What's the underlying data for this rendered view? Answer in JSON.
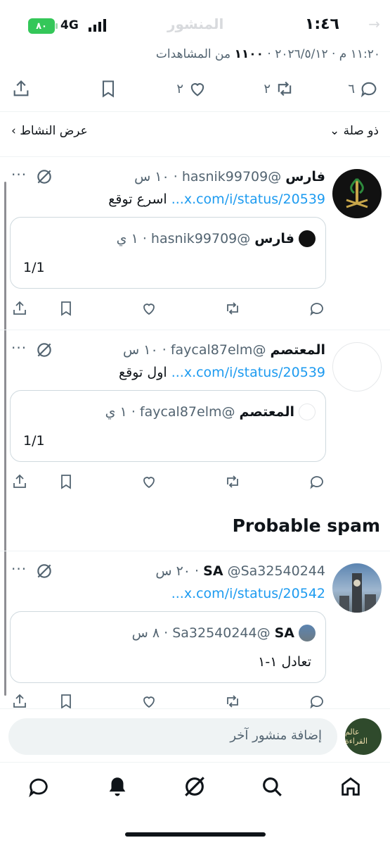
{
  "status_bar": {
    "time": "١:٤٦",
    "network": "4G",
    "battery": "٨٠",
    "faded_title": "المنشور"
  },
  "post_meta": {
    "timestamp": "١١:٢٠ م · ٢٠٢٦/٥/١٢",
    "views_count": "١١٠٠",
    "views_label": "من المشاهدات"
  },
  "post_actions": {
    "replies": "٦",
    "reposts": "٢",
    "likes": "٢"
  },
  "activity_row": {
    "show_activity": "عرض النشاط",
    "relevant": "ذو صلة"
  },
  "replies": [
    {
      "name": "فارس",
      "handle": "@hasnik99709",
      "time": "· ١٠ س",
      "text": "اسرع توقع",
      "link": "x.com/i/status/20539...",
      "quote": {
        "name": "فارس",
        "handle": "@hasnik99709",
        "time": "· ١ ي",
        "text": "1/1"
      }
    },
    {
      "name": "المعتصم",
      "handle": "@faycal87elm",
      "time": "· ١٠ س",
      "text": "اول توقع",
      "link": "x.com/i/status/20539...",
      "quote": {
        "name": "المعتصم",
        "handle": "@faycal87elm",
        "time": "· ١ ي",
        "text": "1/1"
      }
    },
    {
      "name": "SA",
      "handle": "@Sa32540244",
      "time": "· ٢٠ س",
      "text": "",
      "link": "x.com/i/status/20542...",
      "quote": {
        "name": "SA",
        "handle": "@Sa32540244",
        "time": "· ٨ س",
        "text": "تعادل ١-١"
      }
    }
  ],
  "section_title": "Probable spam",
  "composer": {
    "placeholder": "إضافة منشور آخر",
    "self_avatar_text": "عالم القراءة"
  },
  "tabbar": [
    "home",
    "search",
    "grok",
    "notifications",
    "messages"
  ],
  "colors": {
    "accent": "#1d9bf0",
    "text": "#0f1419",
    "muted": "#536471",
    "battery": "#34c759"
  }
}
